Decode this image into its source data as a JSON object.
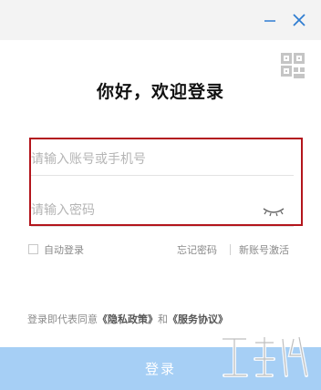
{
  "window": {
    "minimize_icon": "minimize-icon",
    "close_icon": "close-icon"
  },
  "qr_login_icon": "qr-code-icon",
  "title": "你好，欢迎登录",
  "form": {
    "account_placeholder": "请输入账号或手机号",
    "password_placeholder": "请输入密码",
    "account_value": "",
    "password_value": "",
    "show_password_icon": "eye-closed-icon",
    "highlight_color": "#b3151c"
  },
  "options": {
    "auto_login_label": "自动登录",
    "auto_login_checked": false,
    "forgot_password_label": "忘记密码",
    "activate_account_label": "新账号激活"
  },
  "agreement": {
    "prefix": "登录即代表同意",
    "privacy_policy": "《隐私政策》",
    "connector": "和",
    "service_agreement": "《服务协议》"
  },
  "login_button_label": "登录",
  "colors": {
    "button_bg": "#a6cff5",
    "titlebar_bg": "#f3f3f3",
    "window_icon": "#2f7dd1"
  }
}
